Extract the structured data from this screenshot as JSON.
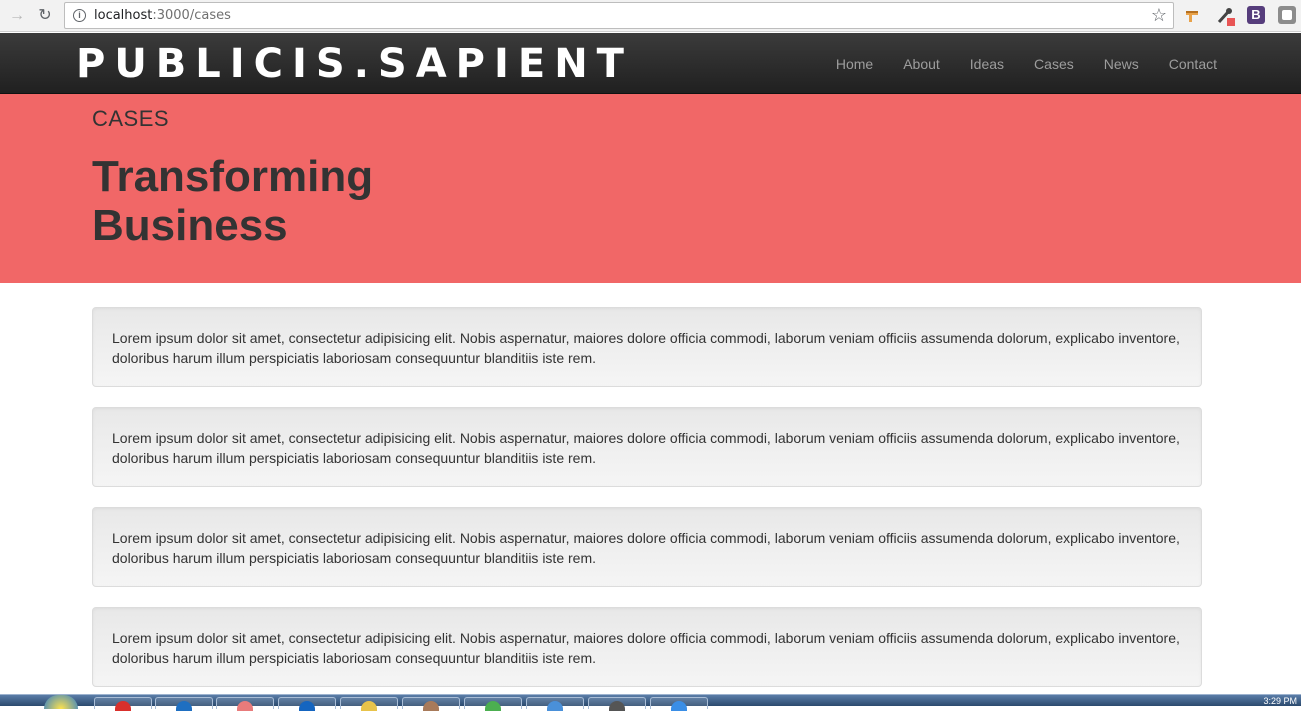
{
  "browser": {
    "url_host": "localhost",
    "url_path": ":3000/cases",
    "extension_b_label": "B"
  },
  "site": {
    "brand": "PUBLICIS.SAPIENT",
    "nav": [
      "Home",
      "About",
      "Ideas",
      "Cases",
      "News",
      "Contact"
    ]
  },
  "hero": {
    "kicker": "CASES",
    "title": "Transforming Business"
  },
  "cards": [
    "Lorem ipsum dolor sit amet, consectetur adipisicing elit. Nobis aspernatur, maiores dolore officia commodi, laborum veniam officiis assumenda dolorum, explicabo inventore, doloribus harum illum perspiciatis laboriosam consequuntur blanditiis iste rem.",
    "Lorem ipsum dolor sit amet, consectetur adipisicing elit. Nobis aspernatur, maiores dolore officia commodi, laborum veniam officiis assumenda dolorum, explicabo inventore, doloribus harum illum perspiciatis laboriosam consequuntur blanditiis iste rem.",
    "Lorem ipsum dolor sit amet, consectetur adipisicing elit. Nobis aspernatur, maiores dolore officia commodi, laborum veniam officiis assumenda dolorum, explicabo inventore, doloribus harum illum perspiciatis laboriosam consequuntur blanditiis iste rem.",
    "Lorem ipsum dolor sit amet, consectetur adipisicing elit. Nobis aspernatur, maiores dolore officia commodi, laborum veniam officiis assumenda dolorum, explicabo inventore, doloribus harum illum perspiciatis laboriosam consequuntur blanditiis iste rem."
  ],
  "taskbar": {
    "clock": "3:29 PM"
  },
  "colors": {
    "hero_bg": "#f16767",
    "nav_bg": "#222222",
    "nav_link": "#9d9d9d",
    "text_dark": "#333333"
  },
  "icons": {
    "back": "back-arrow-icon",
    "reload": "reload-icon",
    "info": "info-icon",
    "bookmark": "star-icon"
  }
}
